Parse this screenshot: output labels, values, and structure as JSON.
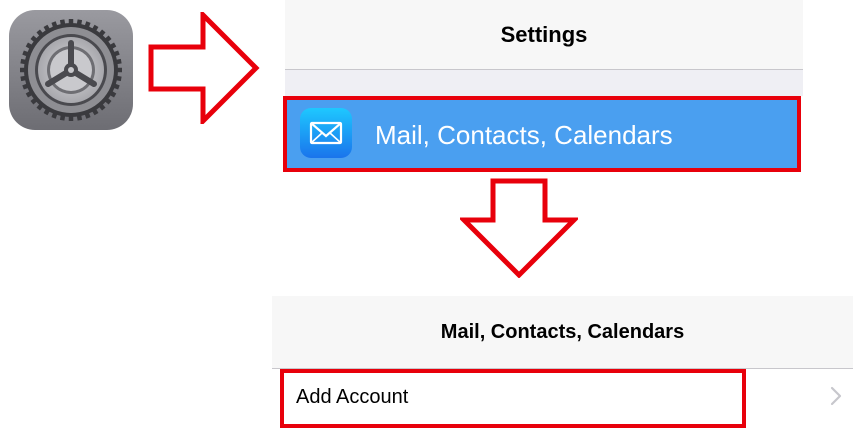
{
  "settings_app_icon": {
    "icon": "settings-gear-icon"
  },
  "settings_screen": {
    "title": "Settings",
    "selected_item": {
      "label": "Mail, Contacts, Calendars",
      "icon": "mail-envelope-icon",
      "highlight_color": "#4a9ff0"
    }
  },
  "mail_screen": {
    "title": "Mail, Contacts, Calendars",
    "items": [
      {
        "label": "Add Account",
        "icon": "chevron-right-icon"
      }
    ]
  },
  "colors": {
    "annotation_red": "#e8000b",
    "header_background": "#f7f7f7"
  }
}
